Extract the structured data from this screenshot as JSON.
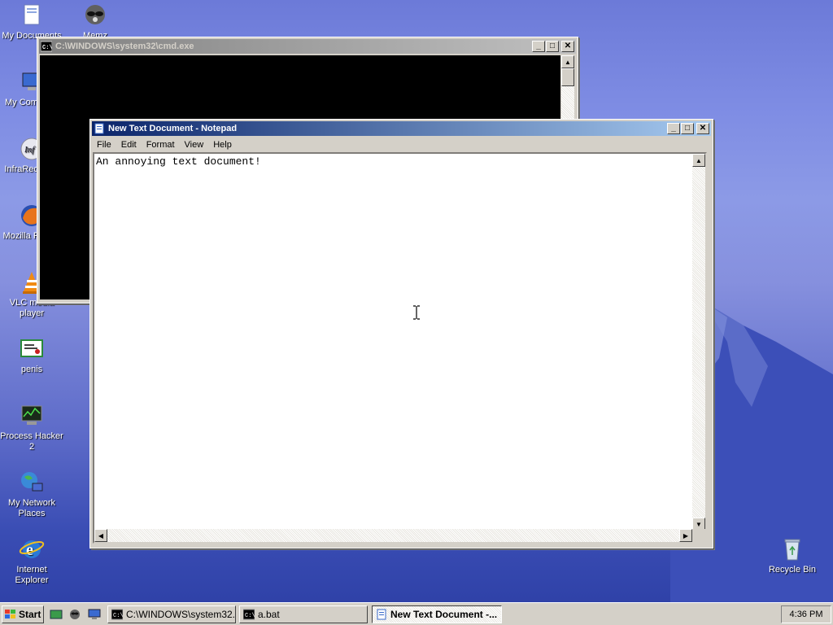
{
  "desktop": {
    "icons": [
      {
        "label": "My Documents"
      },
      {
        "label": "Memz"
      },
      {
        "label": "My Computer"
      },
      {
        "label": "InfraRecorder"
      },
      {
        "label": "Mozilla Firefox"
      },
      {
        "label": "VLC media player"
      },
      {
        "label": "penis"
      },
      {
        "label": "Process Hacker 2"
      },
      {
        "label": "My Network Places"
      },
      {
        "label": "Internet Explorer"
      },
      {
        "label": "Recycle Bin"
      }
    ]
  },
  "cmd_window": {
    "title": "C:\\WINDOWS\\system32\\cmd.exe"
  },
  "notepad": {
    "title": "New Text Document - Notepad",
    "menu": [
      "File",
      "Edit",
      "Format",
      "View",
      "Help"
    ],
    "content": "An annoying text document!"
  },
  "taskbar": {
    "start_label": "Start",
    "buttons": [
      {
        "label": "C:\\WINDOWS\\system32..."
      },
      {
        "label": "a.bat"
      },
      {
        "label": "New Text Document -..."
      }
    ],
    "clock": "4:36 PM"
  },
  "colors": {
    "title_active": "#0a246a",
    "title_inactive": "#808080",
    "chrome": "#d4d0c8"
  }
}
